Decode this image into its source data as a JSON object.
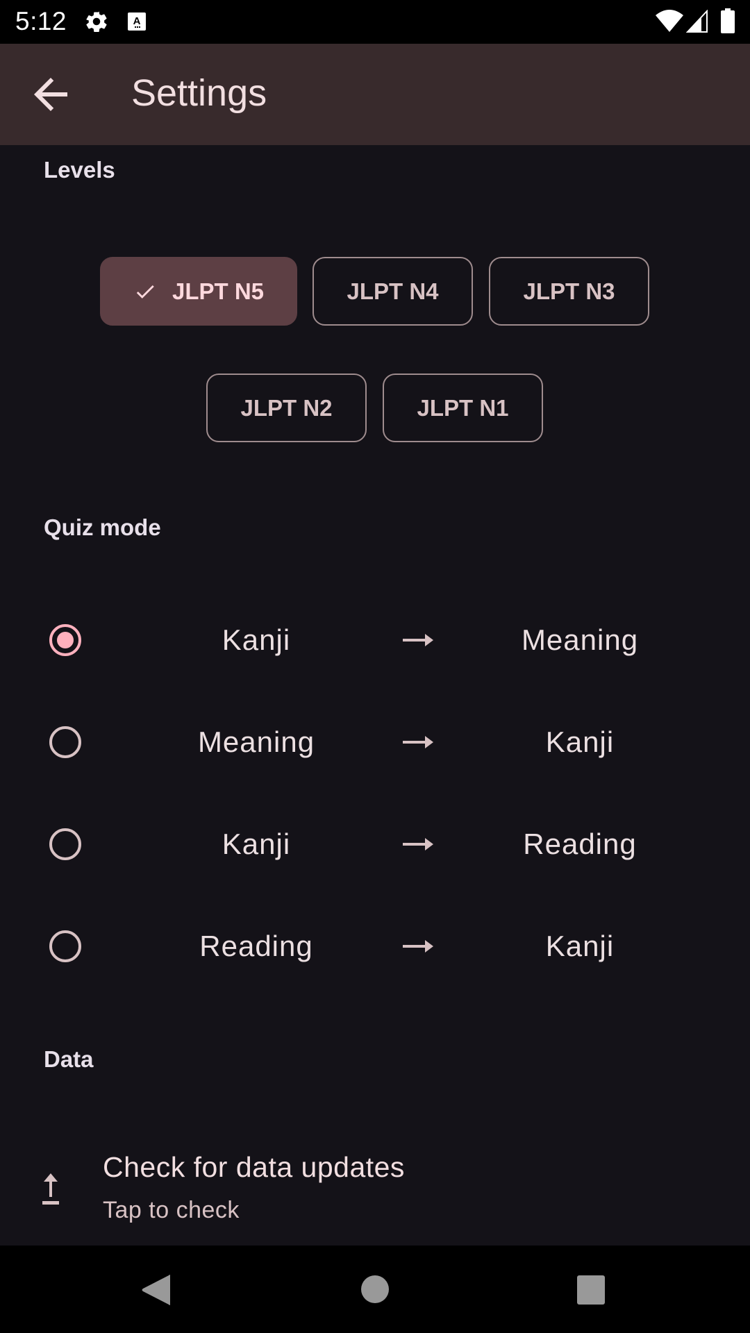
{
  "status_bar": {
    "time": "5:12",
    "icons": [
      "settings-icon",
      "keyboard-a-icon",
      "wifi-icon",
      "signal-icon",
      "battery-icon"
    ]
  },
  "app_bar": {
    "title": "Settings",
    "back_icon": "arrow-back-icon"
  },
  "levels": {
    "title": "Levels",
    "chips": [
      {
        "label": "JLPT N5",
        "selected": true
      },
      {
        "label": "JLPT N4",
        "selected": false
      },
      {
        "label": "JLPT N3",
        "selected": false
      },
      {
        "label": "JLPT N2",
        "selected": false
      },
      {
        "label": "JLPT N1",
        "selected": false
      }
    ]
  },
  "quiz_mode": {
    "title": "Quiz mode",
    "arrow_icon": "arrow-right-icon",
    "options": [
      {
        "from": "Kanji",
        "to": "Meaning",
        "selected": true
      },
      {
        "from": "Meaning",
        "to": "Kanji",
        "selected": false
      },
      {
        "from": "Kanji",
        "to": "Reading",
        "selected": false
      },
      {
        "from": "Reading",
        "to": "Kanji",
        "selected": false
      }
    ]
  },
  "data_section": {
    "title": "Data",
    "item": {
      "icon": "upload-icon",
      "title": "Check for data updates",
      "subtitle": "Tap to check"
    }
  },
  "nav_bar": {
    "buttons": [
      "back",
      "home",
      "recents"
    ]
  },
  "colors": {
    "background": "#141218",
    "app_bar": "#382a2c",
    "accent": "#ffb1be",
    "chip_selected": "#5d3f44",
    "outline": "#9f8c8e"
  }
}
